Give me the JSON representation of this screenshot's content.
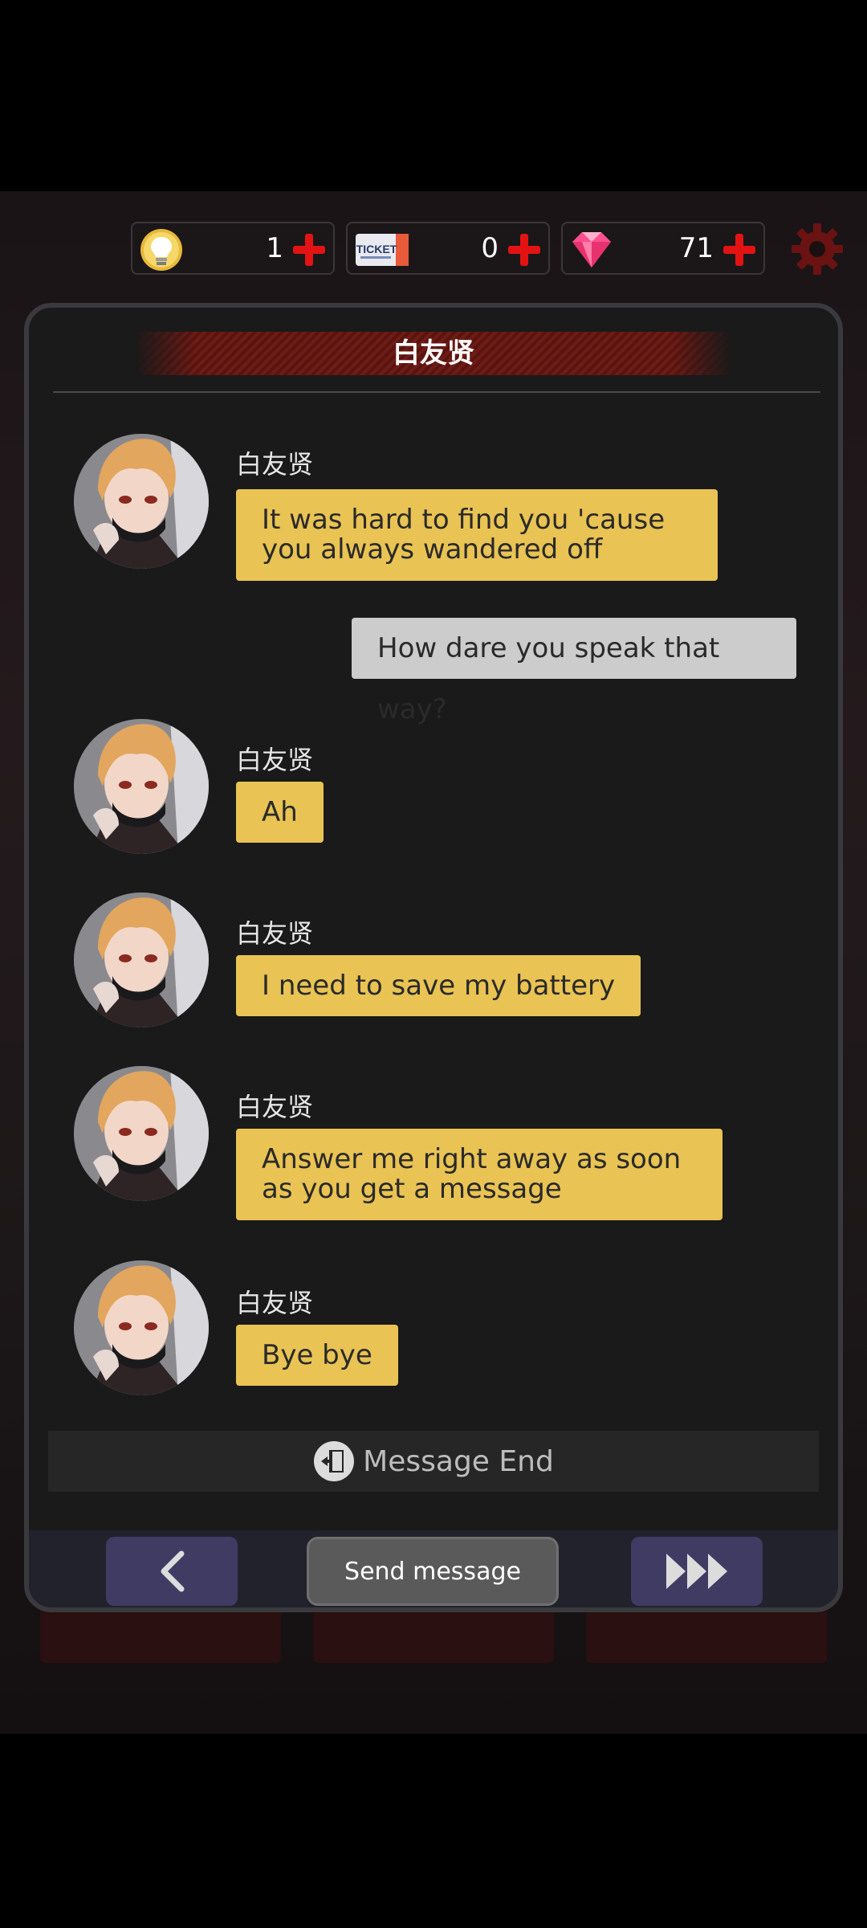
{
  "currencies": [
    {
      "name": "hint",
      "icon": "lightbulb-icon",
      "value": "1"
    },
    {
      "name": "ticket",
      "icon": "ticket-icon",
      "icon_text": "TICKET",
      "value": "0"
    },
    {
      "name": "gem",
      "icon": "gem-icon",
      "value": "71"
    }
  ],
  "settings_icon": "gear-icon",
  "chat": {
    "title": "白友贤",
    "messages": [
      {
        "type": "in",
        "sender": "白友贤",
        "text": "It was hard to find you 'cause you always wandered off"
      },
      {
        "type": "out",
        "text": "How dare you speak that way?"
      },
      {
        "type": "in",
        "sender": "白友贤",
        "text": "Ah"
      },
      {
        "type": "in",
        "sender": "白友贤",
        "text": "I need to save my battery"
      },
      {
        "type": "in",
        "sender": "白友贤",
        "text": "Answer me right away as soon as you get a message"
      },
      {
        "type": "in",
        "sender": "白友贤",
        "text": "Bye bye"
      }
    ],
    "end_label": "Message End"
  },
  "bottom": {
    "back_icon": "chevron-left-icon",
    "send_label": "Send message",
    "skip_icon": "fast-forward-icon"
  },
  "colors": {
    "incoming_bubble": "#e9c353",
    "outgoing_bubble": "#cccccc",
    "panel_bg": "#1a1a1a",
    "accent_red": "#e31313",
    "nav_button": "#3f3b62"
  }
}
